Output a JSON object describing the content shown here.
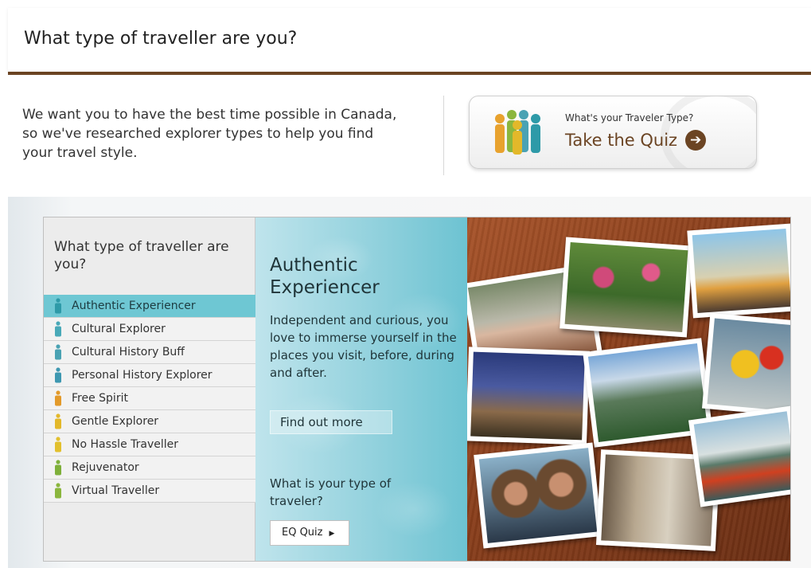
{
  "header": {
    "title": "What type of traveller are you?"
  },
  "intro": {
    "text": "We want you to have the best time possible in Canada, so we've researched explorer types to help you find your travel style."
  },
  "quiz_button": {
    "subtitle": "What's your Traveler Type?",
    "label": "Take the Quiz",
    "arrow": "➔"
  },
  "widget": {
    "sidebar_title": "What type of traveller are you?",
    "types": [
      {
        "label": "Authentic Experiencer",
        "color": "#2e9aa8",
        "active": true
      },
      {
        "label": "Cultural Explorer",
        "color": "#49a9b8",
        "active": false
      },
      {
        "label": "Cultural History Buff",
        "color": "#4aa2b3",
        "active": false
      },
      {
        "label": "Personal History Explorer",
        "color": "#3e98b1",
        "active": false
      },
      {
        "label": "Free Spirit",
        "color": "#e39a2a",
        "active": false
      },
      {
        "label": "Gentle Explorer",
        "color": "#e3b82a",
        "active": false
      },
      {
        "label": "No Hassle Traveller",
        "color": "#e2c02e",
        "active": false
      },
      {
        "label": "Rejuvenator",
        "color": "#7fb03a",
        "active": false
      },
      {
        "label": "Virtual Traveller",
        "color": "#8bb63e",
        "active": false
      }
    ],
    "detail": {
      "title": "Authentic Experiencer",
      "description": "Independent and curious, you love to immerse yourself in the places you visit, before, during and after.",
      "find_more": "Find out more",
      "question": "What is your type of traveler?",
      "quiz_label": "EQ Quiz",
      "quiz_arrow": "▶"
    }
  },
  "colors": {
    "brand_brown": "#6b4423",
    "teal": "#6ec7d3"
  }
}
